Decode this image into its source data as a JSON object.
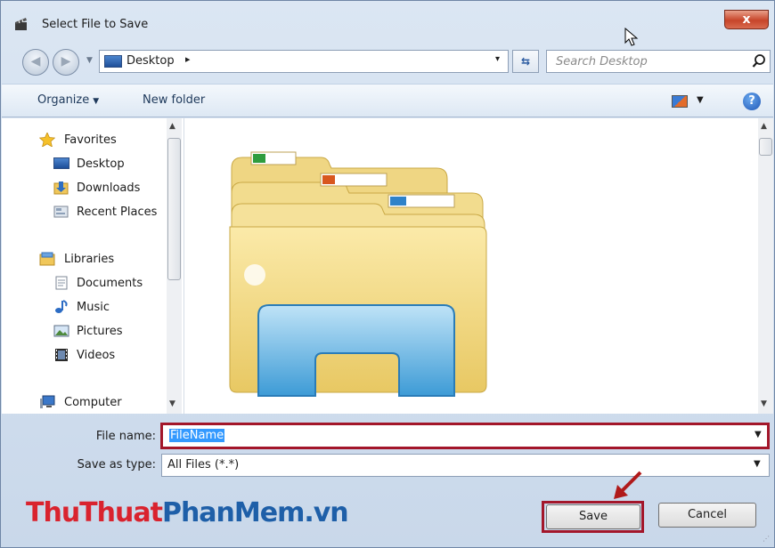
{
  "window": {
    "title": "Select File to Save",
    "close_label": "x"
  },
  "address": {
    "location": "Desktop",
    "separator_arrow": "▸",
    "dropdown": "▾",
    "refresh_symbol": "⇆"
  },
  "search": {
    "placeholder": "Search Desktop"
  },
  "toolbar": {
    "organize": "Organize",
    "new_folder": "New folder",
    "help": "?"
  },
  "sidebar": {
    "items": [
      {
        "label": "Favorites",
        "icon": "star-icon"
      },
      {
        "label": "Desktop",
        "icon": "desktop-icon"
      },
      {
        "label": "Downloads",
        "icon": "downloads-icon"
      },
      {
        "label": "Recent Places",
        "icon": "recent-places-icon"
      },
      {
        "label": "Libraries",
        "icon": "libraries-icon"
      },
      {
        "label": "Documents",
        "icon": "documents-icon"
      },
      {
        "label": "Music",
        "icon": "music-icon"
      },
      {
        "label": "Pictures",
        "icon": "pictures-icon"
      },
      {
        "label": "Videos",
        "icon": "videos-icon"
      },
      {
        "label": "Computer",
        "icon": "computer-icon"
      }
    ]
  },
  "file_name": {
    "label": "File name:",
    "value": "FileName"
  },
  "save_type": {
    "label": "Save as type:",
    "value": "All Files (*.*)"
  },
  "buttons": {
    "save": "Save",
    "cancel": "Cancel"
  },
  "watermark": {
    "part1": "ThuThuat",
    "part2": "PhanMem",
    "part3": ".vn"
  },
  "colors": {
    "highlight_red": "#a3162a",
    "selection_blue": "#3399ff"
  }
}
